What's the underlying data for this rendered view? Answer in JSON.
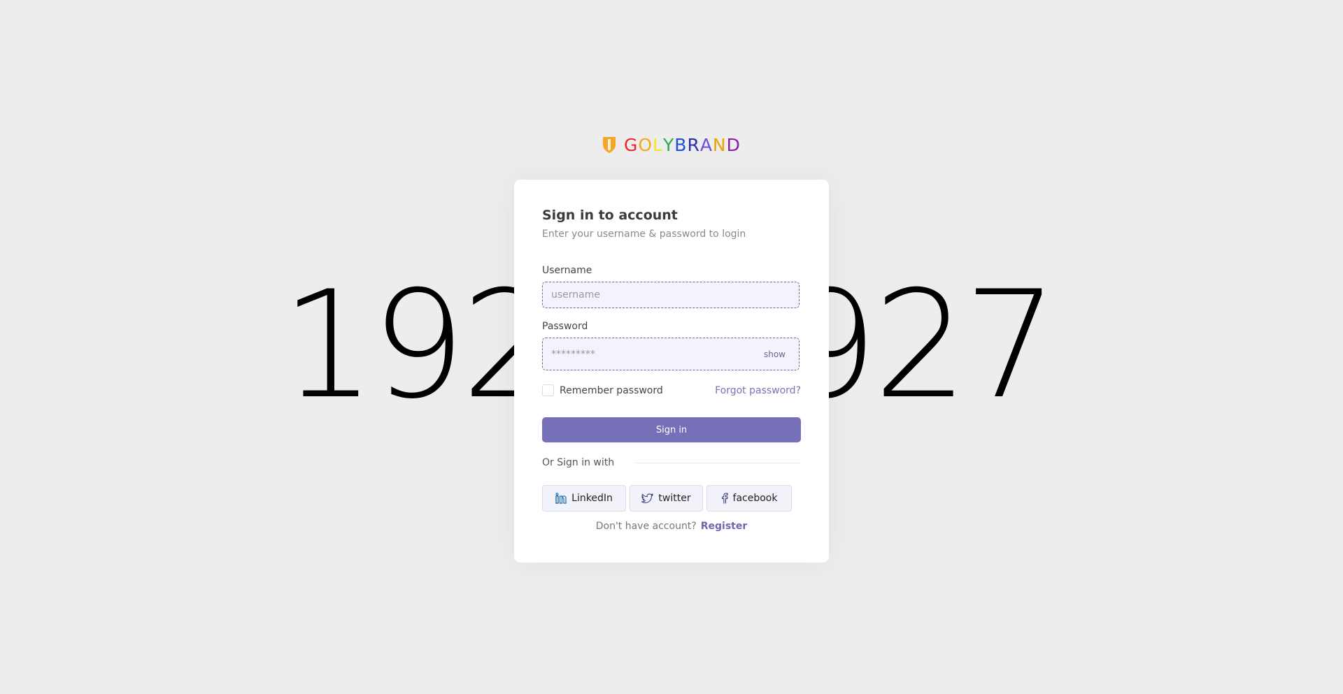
{
  "background": {
    "left_text": "192",
    "right_text": "927"
  },
  "brand": {
    "name_letters": [
      {
        "char": "G",
        "color": "#e8252b"
      },
      {
        "char": "O",
        "color": "#f5a623"
      },
      {
        "char": "L",
        "color": "#f8e71c"
      },
      {
        "char": "Y",
        "color": "#2ea84a"
      },
      {
        "char": "B",
        "color": "#1f4fd8"
      },
      {
        "char": "R",
        "color": "#2b2fa8"
      },
      {
        "char": "A",
        "color": "#6a4fd8"
      },
      {
        "char": "N",
        "color": "#e8a400"
      },
      {
        "char": "D",
        "color": "#8b1fa8"
      }
    ],
    "icon": "shield-icon",
    "icon_color": "#f5a623"
  },
  "form": {
    "title": "Sign in to account",
    "subtitle": "Enter your username & password to login",
    "username_label": "Username",
    "username_placeholder": "username",
    "username_value": "",
    "password_label": "Password",
    "password_placeholder": "*********",
    "password_value": "",
    "show_label": "show",
    "remember_label": "Remember password",
    "remember_checked": false,
    "forgot_label": "Forgot password?",
    "signin_label": "Sign in",
    "or_label": "Or Sign in with",
    "social": [
      {
        "label": "LinkedIn",
        "icon": "linkedin-icon"
      },
      {
        "label": "twitter",
        "icon": "twitter-icon"
      },
      {
        "label": "facebook",
        "icon": "facebook-icon"
      }
    ],
    "no_account_text": "Don't have account?",
    "register_label": "Register"
  },
  "colors": {
    "accent": "#7670b8",
    "field_bg": "#f3f2fd",
    "page_bg": "#ededed"
  }
}
